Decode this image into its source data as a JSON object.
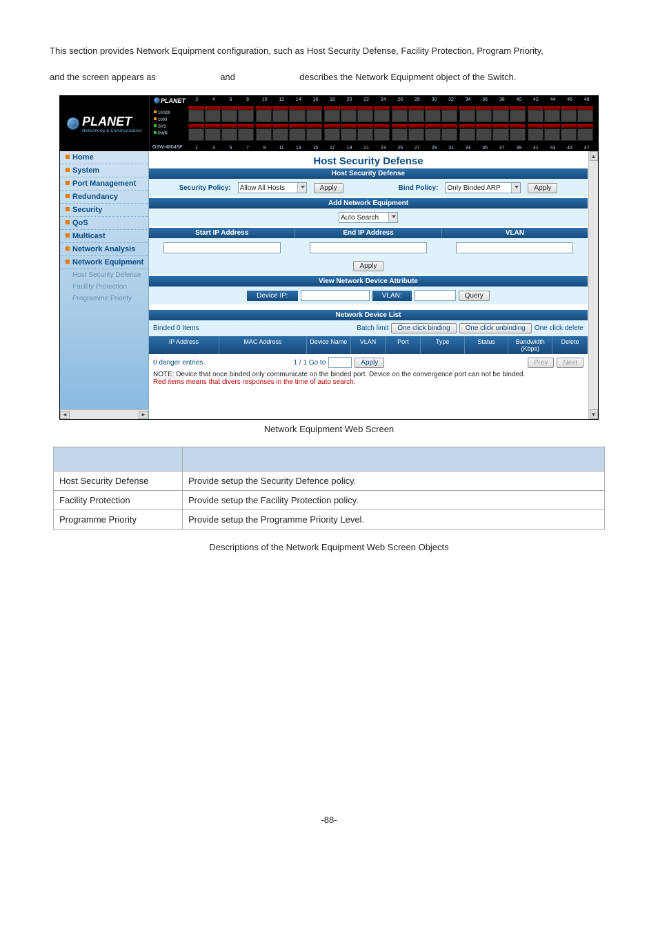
{
  "intro": {
    "line1": "This section provides Network Equipment configuration, such as Host Security Defense, Facility Protection, Program Priority,",
    "line2_a": "and the screen appears as",
    "line2_b": "and",
    "line2_c": "describes the Network Equipment object of the Switch."
  },
  "device": {
    "brand": "PLANET",
    "brand_sub": "Networking & Communication",
    "mini_brand": "PLANET",
    "model": "GSW-4804SF",
    "leds": {
      "l1": "10/100",
      "l2": "1000",
      "l3": "SYS",
      "l4": "PWR"
    },
    "ports_top": [
      "2",
      "4",
      "6",
      "8",
      "10",
      "12",
      "14",
      "16",
      "18",
      "20",
      "22",
      "24",
      "26",
      "28",
      "30",
      "32",
      "34",
      "36",
      "38",
      "40",
      "42",
      "44",
      "46",
      "48"
    ],
    "ports_bottom": [
      "1",
      "3",
      "5",
      "7",
      "9",
      "11",
      "13",
      "15",
      "17",
      "19",
      "21",
      "23",
      "25",
      "27",
      "29",
      "31",
      "33",
      "35",
      "37",
      "39",
      "41",
      "43",
      "45",
      "47"
    ]
  },
  "sidebar": {
    "items": [
      {
        "label": "Home"
      },
      {
        "label": "System"
      },
      {
        "label": "Port Management"
      },
      {
        "label": "Redundancy"
      },
      {
        "label": "Security"
      },
      {
        "label": "QoS"
      },
      {
        "label": "Multicast"
      },
      {
        "label": "Network Analysis"
      },
      {
        "label": "Network Equipment"
      }
    ],
    "subs": [
      {
        "label": "Host Security Defense"
      },
      {
        "label": "Facility Protection"
      },
      {
        "label": "Programme Priority"
      }
    ]
  },
  "content": {
    "title": "Host Security Defense",
    "hsd_bar": "Host Security Defense",
    "security_policy_label": "Security Policy:",
    "security_policy_value": "Allow All Hosts",
    "apply": "Apply",
    "bind_policy_label": "Bind Policy:",
    "bind_policy_value": "Only Binded ARP",
    "add_bar": "Add Network Equipment",
    "auto_search": "Auto Search",
    "cols3": {
      "start": "Start IP Address",
      "end": "End IP Address",
      "vlan": "VLAN"
    },
    "view_bar": "View Network Device Attribute",
    "device_ip_label": "Device IP:",
    "vlan_label": "VLAN:",
    "query": "Query",
    "list_bar": "Network Device List",
    "binded": "Binded 0 Items",
    "batch_limit": "Batch limit",
    "one_bind": "One click binding",
    "one_unbind": "One click unbinding",
    "one_delete": "One click delete",
    "thead": {
      "ip": "IP Address",
      "mac": "MAC Address",
      "devname": "Device Name",
      "vlan": "VLAN",
      "port": "Port",
      "type": "Type",
      "status": "Status",
      "bw": "Bandwidth (Kbps)",
      "del": "Delete"
    },
    "danger": "0 danger entries",
    "goto_prefix": "1 / 1 Go to",
    "prev": "Prev",
    "next": "Next",
    "note1": "NOTE: Device that once binded only communicate on the binded port. Device on the convergence port can not be binded.",
    "note2": "Red items means that divers responses in the time of auto search."
  },
  "caption1": "Network Equipment Web Screen",
  "table": {
    "rows": [
      {
        "obj": "Host Security Defense",
        "desc": "Provide setup the Security Defence policy."
      },
      {
        "obj": "Facility Protection",
        "desc": "Provide setup the Facility Protection policy."
      },
      {
        "obj": "Programme Priority",
        "desc": "Provide setup the Programme Priority Level."
      }
    ]
  },
  "caption2": "Descriptions of the Network Equipment Web Screen Objects",
  "page_number": "-88-"
}
